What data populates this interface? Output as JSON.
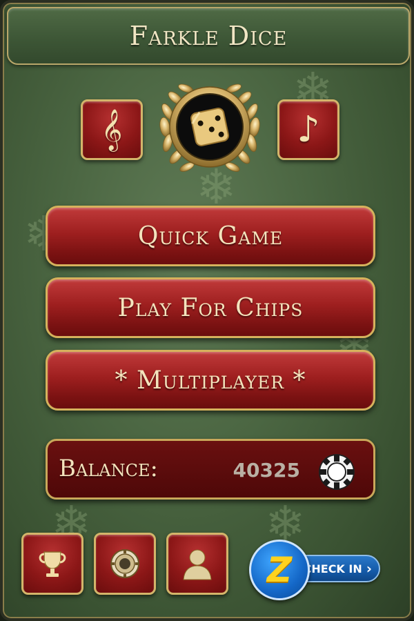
{
  "app": {
    "title": "Farkle Dice"
  },
  "top_controls": [
    {
      "name": "sound-fx-button",
      "icon": "treble-clef-icon"
    },
    {
      "name": "music-button",
      "icon": "music-note-icon"
    }
  ],
  "emblem": {
    "icon": "dice-laurel-icon"
  },
  "menu": {
    "quick_game": "Quick Game",
    "play_for_chips": "Play For Chips",
    "multiplayer": "* Multiplayer *"
  },
  "balance": {
    "label": "Balance:",
    "value": "40325",
    "icon": "poker-chip-icon"
  },
  "bottom_controls": [
    {
      "name": "achievements-button",
      "icon": "trophy-icon"
    },
    {
      "name": "chips-shop-button",
      "icon": "coin-icon"
    },
    {
      "name": "profile-button",
      "icon": "user-silhouette-icon"
    }
  ],
  "checkin": {
    "label": "CHECK IN",
    "arrow": "›",
    "badge": "Z"
  },
  "colors": {
    "felt": "#4b6642",
    "button_red": "#9e1f1f",
    "gold_border": "#d6b25c",
    "text_cream": "#f4e4bd",
    "checkin_blue": "#145aa8"
  }
}
